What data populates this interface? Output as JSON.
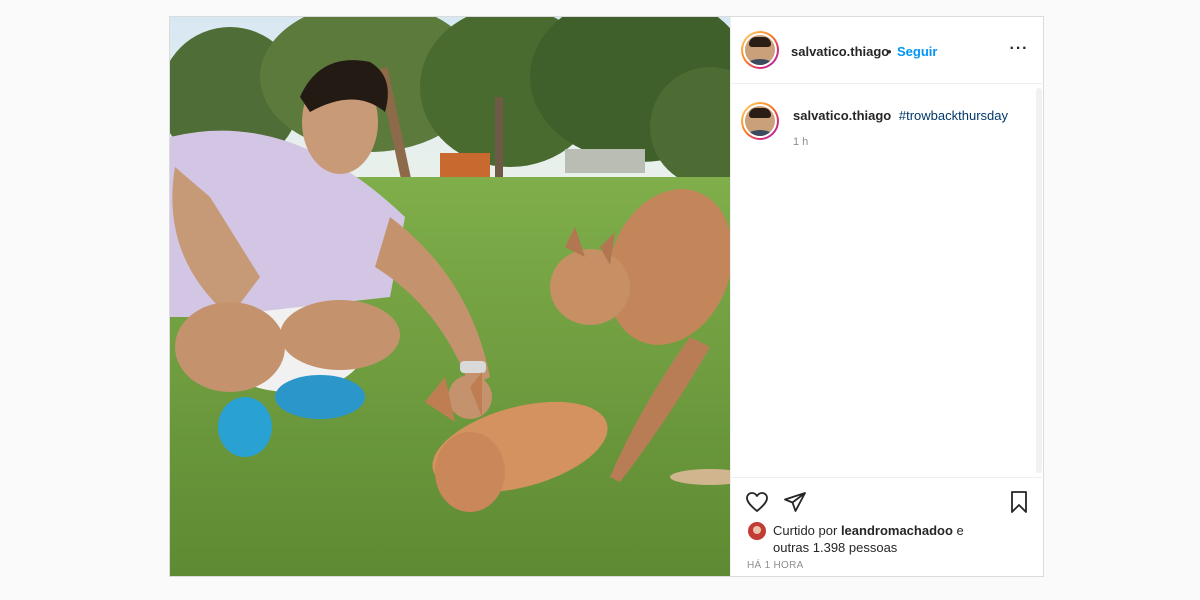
{
  "post": {
    "username": "salvatico.thiago",
    "separator": "•",
    "follow_label": "Seguir",
    "more_icon": "more-horizontal-icon",
    "caption": {
      "username": "salvatico.thiago",
      "hashtag": "#trowbackthursday",
      "time": "1 h"
    },
    "likes": {
      "prefix": "Curtido por",
      "user": "leandromachadoo",
      "conjunction": "e",
      "others": "outras 1.398 pessoas"
    },
    "age": "HÁ 1 HORA"
  },
  "icons": {
    "like": "heart-icon",
    "share": "paper-plane-icon",
    "save": "bookmark-icon"
  },
  "colors": {
    "link": "#0095f6",
    "hashtag": "#00376b",
    "text": "#262626",
    "muted": "#8e8e8e"
  }
}
